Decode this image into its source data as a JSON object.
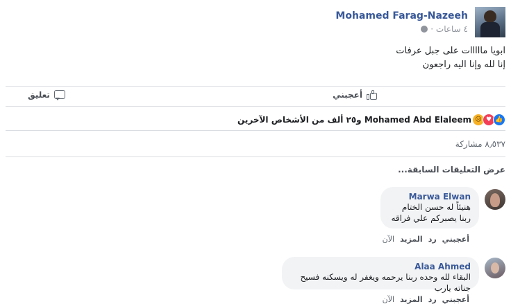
{
  "post": {
    "author": "Mohamed Farag-Nazeeh",
    "time": "٤ ساعات ·",
    "lines": [
      "ابويا مااااات على جبل عرفات",
      "إنا لله وإنا اليه راجعون"
    ]
  },
  "actions": {
    "like": "أعجبني",
    "comment": "تعليق"
  },
  "reactions": {
    "icons": [
      "sad-icon",
      "love-icon",
      "like-icon"
    ],
    "text": "Mohamed Abd Elaleem و٢٥ ألف من الأشخاص الآخرين"
  },
  "shares": "٨٫٥٣٧ مشاركة",
  "previous_comments": "عرض التعليقات السابقة...",
  "comments": [
    {
      "name": "Marwa Elwan",
      "lines": [
        "هنيئاً له حسن الختام",
        "ربنا يصبركم علي فراقه"
      ],
      "actions": [
        "أعجبني",
        "رد",
        "المزيد"
      ],
      "time": "الآن"
    },
    {
      "name": "Alaa Ahmed",
      "lines": [
        "البقاء لله وحده ربنا يرحمه ويغفر له ويسكنه فسيح جناته يارب"
      ],
      "actions": [
        "أعجبني",
        "رد",
        "المزيد"
      ],
      "time": "الآن"
    }
  ],
  "colors": {
    "link": "#385898",
    "like_blue": "#1877f2",
    "love_red": "#f33e58",
    "sad_yellow": "#f7b125"
  }
}
